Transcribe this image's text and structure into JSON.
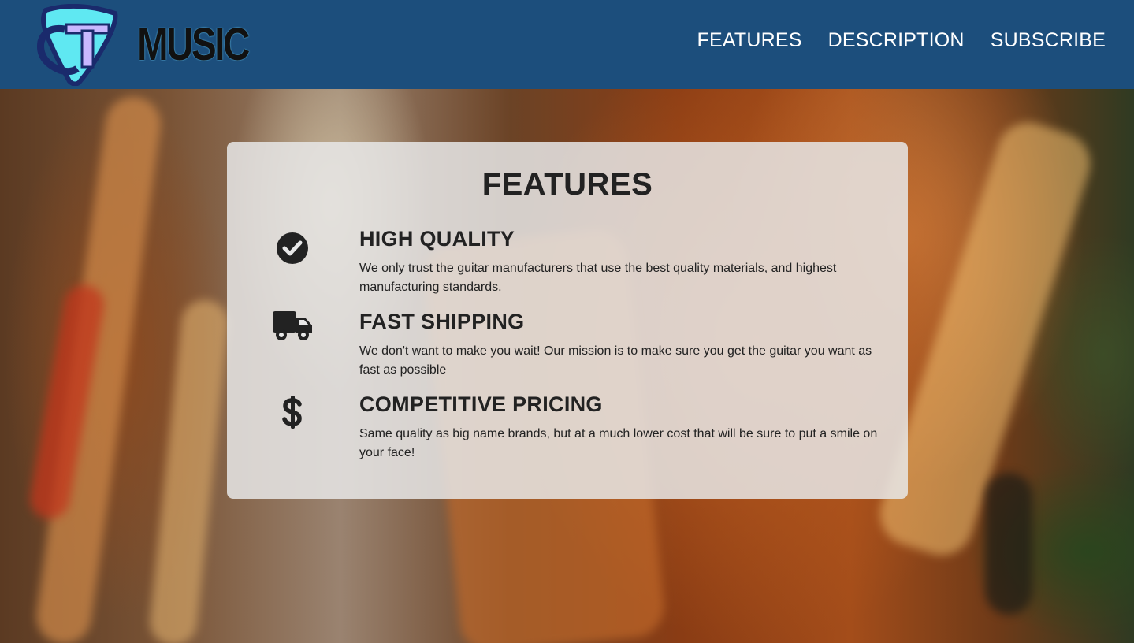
{
  "header": {
    "brand": {
      "logo_text": "CT",
      "name": "MUSIC"
    },
    "nav": [
      {
        "label": "FEATURES"
      },
      {
        "label": "DESCRIPTION"
      },
      {
        "label": "SUBSCRIBE"
      }
    ],
    "colors": {
      "background": "#1c4e7c",
      "logo_cyan": "#5fe8f2",
      "logo_navy": "#1a2a6c"
    }
  },
  "features": {
    "title": "FEATURES",
    "items": [
      {
        "icon": "check-circle-icon",
        "heading": "HIGH QUALITY",
        "description": "We only trust the guitar manufacturers that use the best quality materials, and highest manufacturing standards."
      },
      {
        "icon": "truck-icon",
        "heading": "FAST SHIPPING",
        "description": "We don't want to make you wait! Our mission is to make sure you get the guitar you want as fast as possible"
      },
      {
        "icon": "dollar-sign-icon",
        "heading": "COMPETITIVE PRICING",
        "description": "Same quality as big name brands, but at a much lower cost that will be sure to put a smile on your face!"
      }
    ]
  }
}
